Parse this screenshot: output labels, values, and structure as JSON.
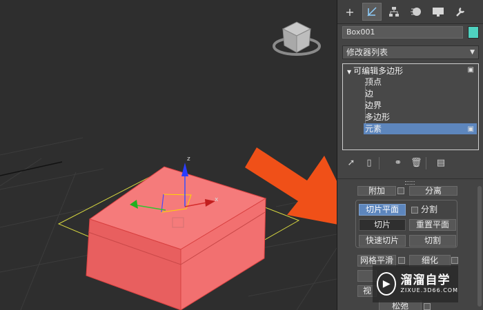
{
  "viewport": {
    "axis_labels": {
      "z": "z",
      "x": "x"
    }
  },
  "panel": {
    "tabs": [
      {
        "icon": "create-plus-icon"
      },
      {
        "icon": "modify-icon"
      },
      {
        "icon": "hierarchy-icon"
      },
      {
        "icon": "motion-icon"
      },
      {
        "icon": "display-icon"
      },
      {
        "icon": "utilities-wrench-icon"
      }
    ],
    "object_name": "Box001",
    "object_color": "#4fd2c0",
    "modifier_list": "修改器列表",
    "stack": {
      "root": "可编辑多边形",
      "subobjects": [
        "顶点",
        "边",
        "边界",
        "多边形",
        "元素"
      ],
      "selected": "元素"
    },
    "buttons": {
      "attach": "附加",
      "detach": "分离",
      "slice_plane": "切片平面",
      "split": "分割",
      "slice": "切片",
      "reset_plane": "重置平面",
      "quick_slice": "快速切片",
      "cut": "切割",
      "meshsmooth": "网格平滑",
      "tessellate": "细化",
      "view_align": "视",
      "relax": "松弛"
    }
  },
  "watermark": {
    "title": "溜溜自学",
    "url": "ZIXUE.3D66.COM"
  }
}
